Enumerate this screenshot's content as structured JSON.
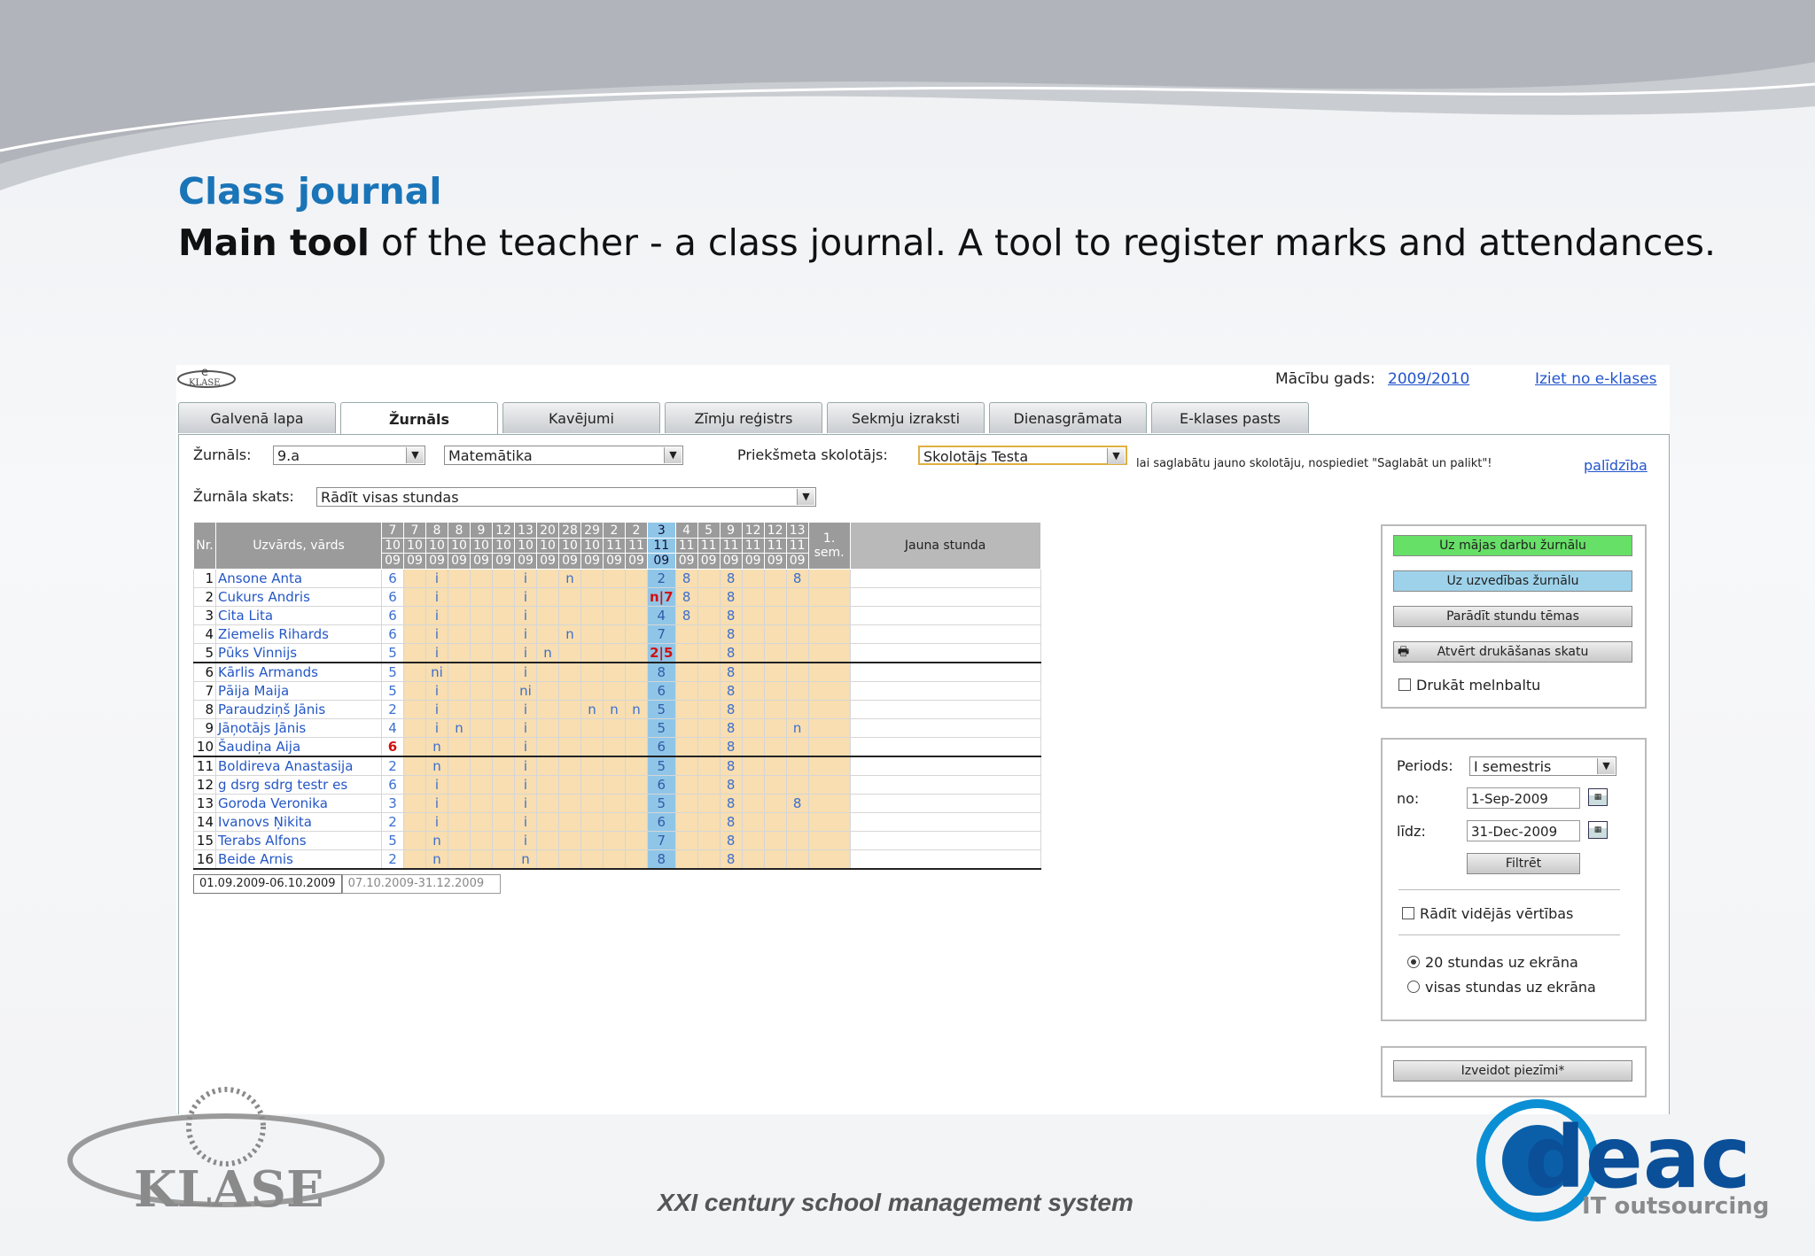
{
  "slide": {
    "title": "Class journal",
    "subtitle_bold": "Main tool",
    "subtitle_rest": " of the teacher -  a class journal. A tool to register marks and attendances.",
    "tagline": "XXI century school management system",
    "klase_logo_text": "KLASE",
    "deac_logo_text": "deac",
    "deac_sub": "IT outsourcing"
  },
  "app": {
    "logo_text": "KLASE",
    "year_label": "Mācību gads:",
    "year_value": "2009/2010",
    "logout": "Iziet no e-klases",
    "tabs": [
      "Galvenā lapa",
      "Žurnāls",
      "Kavējumi",
      "Zīmju reģistrs",
      "Sekmju izraksti",
      "Dienasgrāmata",
      "E-klases pasts"
    ],
    "active_tab": "Žurnāls",
    "filters": {
      "journal_label": "Žurnāls:",
      "journal_value": "9.a",
      "subject_value": "Matemātika",
      "teacher_label": "Priekšmeta skolotājs:",
      "teacher_value": "Skolotājs Testa",
      "teacher_note": "lai saglabātu jauno skolotāju, nospiediet \"Saglabāt un palikt\"!",
      "help": "palīdzība",
      "view_label": "Žurnāla skats:",
      "view_value": "Rādīt visas stundas"
    },
    "table": {
      "col_nr": "Nr.",
      "col_name": "Uzvārds, vārds",
      "dates": [
        [
          "7",
          "10",
          "09"
        ],
        [
          "7",
          "10",
          "09"
        ],
        [
          "8",
          "10",
          "09"
        ],
        [
          "8",
          "10",
          "09"
        ],
        [
          "9",
          "10",
          "09"
        ],
        [
          "12",
          "10",
          "09"
        ],
        [
          "13",
          "10",
          "09"
        ],
        [
          "20",
          "10",
          "09"
        ],
        [
          "28",
          "10",
          "09"
        ],
        [
          "29",
          "10",
          "09"
        ],
        [
          "2",
          "11",
          "09"
        ],
        [
          "2",
          "11",
          "09"
        ],
        [
          "3",
          "11",
          "09"
        ],
        [
          "4",
          "11",
          "09"
        ],
        [
          "5",
          "11",
          "09"
        ],
        [
          "9",
          "11",
          "09"
        ],
        [
          "12",
          "11",
          "09"
        ],
        [
          "12",
          "11",
          "09"
        ],
        [
          "13",
          "11",
          "09"
        ]
      ],
      "highlight_col": 12,
      "sem_label": "1. sem.",
      "new_lesson": "Jauna stunda",
      "rows": [
        {
          "nr": "1",
          "name": "Ansone Anta",
          "m": [
            "6",
            "",
            "i",
            "",
            "",
            "",
            "i",
            "",
            "n",
            "",
            "",
            "",
            "2",
            "8",
            "",
            "8",
            "",
            "",
            "8"
          ]
        },
        {
          "nr": "2",
          "name": "Cukurs Andris",
          "m": [
            "6",
            "",
            "i",
            "",
            "",
            "",
            "i",
            "",
            "",
            "",
            "",
            "",
            "n|7",
            "8",
            "",
            "8",
            "",
            "",
            ""
          ]
        },
        {
          "nr": "3",
          "name": "Cita Lita",
          "m": [
            "6",
            "",
            "i",
            "",
            "",
            "",
            "i",
            "",
            "",
            "",
            "",
            "",
            "4",
            "8",
            "",
            "8",
            "",
            "",
            ""
          ]
        },
        {
          "nr": "4",
          "name": "Ziemelis Rihards",
          "m": [
            "6",
            "",
            "i",
            "",
            "",
            "",
            "i",
            "",
            "n",
            "",
            "",
            "",
            "7",
            "",
            "",
            "8",
            "",
            "",
            ""
          ]
        },
        {
          "nr": "5",
          "name": "Pūks Vinnijs",
          "m": [
            "5",
            "",
            "i",
            "",
            "",
            "",
            "i",
            "n",
            "",
            "",
            "",
            "",
            "2|5",
            "",
            "",
            "8",
            "",
            "",
            ""
          ]
        },
        {
          "nr": "6",
          "name": "Kārlis Armands",
          "m": [
            "5",
            "",
            "ni",
            "",
            "",
            "",
            "i",
            "",
            "",
            "",
            "",
            "",
            "8",
            "",
            "",
            "8",
            "",
            "",
            ""
          ]
        },
        {
          "nr": "7",
          "name": "Pāija Maija",
          "m": [
            "5",
            "",
            "i",
            "",
            "",
            "",
            "ni",
            "",
            "",
            "",
            "",
            "",
            "6",
            "",
            "",
            "8",
            "",
            "",
            ""
          ]
        },
        {
          "nr": "8",
          "name": "Paraudziņš Jānis",
          "m": [
            "2",
            "",
            "i",
            "",
            "",
            "",
            "i",
            "",
            "",
            "n",
            "n",
            "n",
            "5",
            "",
            "",
            "8",
            "",
            "",
            ""
          ]
        },
        {
          "nr": "9",
          "name": "Jāņotājs Jānis",
          "m": [
            "4",
            "",
            "i",
            "n",
            "",
            "",
            "i",
            "",
            "",
            "",
            "",
            "",
            "5",
            "",
            "",
            "8",
            "",
            "",
            "n"
          ]
        },
        {
          "nr": "10",
          "name": "Šaudiņa Aija",
          "m": [
            "6",
            "",
            "n",
            "",
            "",
            "",
            "i",
            "",
            "",
            "",
            "",
            "",
            "6",
            "",
            "",
            "8",
            "",
            "",
            ""
          ]
        },
        {
          "nr": "11",
          "name": "Boldireva Anastasija",
          "m": [
            "2",
            "",
            "n",
            "",
            "",
            "",
            "i",
            "",
            "",
            "",
            "",
            "",
            "5",
            "",
            "",
            "8",
            "",
            "",
            ""
          ]
        },
        {
          "nr": "12",
          "name": "g dsrg sdrg testr es",
          "m": [
            "6",
            "",
            "i",
            "",
            "",
            "",
            "i",
            "",
            "",
            "",
            "",
            "",
            "6",
            "",
            "",
            "8",
            "",
            "",
            ""
          ]
        },
        {
          "nr": "13",
          "name": "Goroda Veronika",
          "m": [
            "3",
            "",
            "i",
            "",
            "",
            "",
            "i",
            "",
            "",
            "",
            "",
            "",
            "5",
            "",
            "",
            "8",
            "",
            "",
            "8"
          ]
        },
        {
          "nr": "14",
          "name": "Ivanovs Ņikita",
          "m": [
            "2",
            "",
            "i",
            "",
            "",
            "",
            "i",
            "",
            "",
            "",
            "",
            "",
            "6",
            "",
            "",
            "8",
            "",
            "",
            ""
          ]
        },
        {
          "nr": "15",
          "name": "Terabs Alfons",
          "m": [
            "5",
            "",
            "n",
            "",
            "",
            "",
            "i",
            "",
            "",
            "",
            "",
            "",
            "7",
            "",
            "",
            "8",
            "",
            "",
            ""
          ]
        },
        {
          "nr": "16",
          "name": "Beide Arnis",
          "m": [
            "2",
            "",
            "n",
            "",
            "",
            "",
            "n",
            "",
            "",
            "",
            "",
            "",
            "8",
            "",
            "",
            "8",
            "",
            "",
            ""
          ]
        }
      ],
      "red_cells": [
        [
          "2",
          12
        ],
        [
          "5",
          12
        ],
        [
          "10",
          0
        ]
      ],
      "period_tabs": [
        "01.09.2009-06.10.2009",
        "07.10.2009-31.12.2009"
      ]
    },
    "actions": {
      "btn_homework": "Uz mājas darbu žurnālu",
      "btn_conduct": "Uz uzvedības žurnālu",
      "btn_topics": "Parādīt stundu tēmas",
      "btn_print": "Atvērt drukāšanas skatu",
      "chk_bw": "Drukāt melnbaltu"
    },
    "period_box": {
      "period_label": "Periods:",
      "period_value": "I semestris",
      "from_label": "no:",
      "from_value": "1-Sep-2009",
      "to_label": "līdz:",
      "to_value": "31-Dec-2009",
      "filter_btn": "Filtrēt",
      "chk_avg": "Rādīt vidējās vērtības",
      "radio_20": "20 stundas uz ekrāna",
      "radio_all": "visas stundas uz ekrāna"
    },
    "note_btn": "Izveidot piezīmi*"
  }
}
